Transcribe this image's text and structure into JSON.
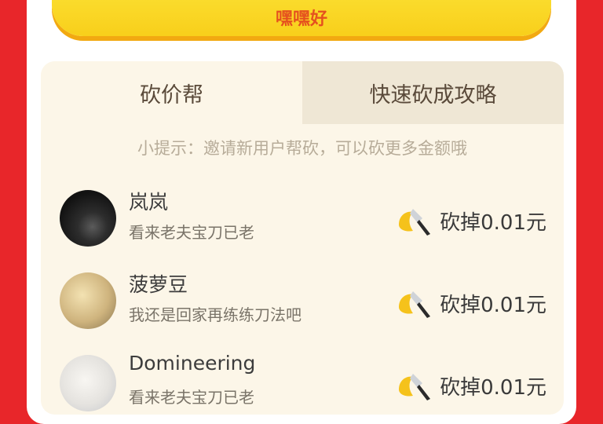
{
  "cta": {
    "label": "嘿嘿好"
  },
  "tabs": [
    {
      "label": "砍价帮"
    },
    {
      "label": "快速砍成攻略"
    }
  ],
  "hint": "小提示：邀请新用户帮砍，可以砍更多金额哦",
  "helpers": [
    {
      "name": "岚岚",
      "message": "看来老夫宝刀已老",
      "amount": "砍掉0.01元",
      "avatar": "dark-photo-avatar"
    },
    {
      "name": "菠萝豆",
      "message": "我还是回家再练练刀法吧",
      "amount": "砍掉0.01元",
      "avatar": "cartoon-avatar"
    },
    {
      "name": "Domineering",
      "message": "看来老夫宝刀已老",
      "amount": "砍掉0.01元",
      "avatar": "light-photo-avatar"
    }
  ]
}
